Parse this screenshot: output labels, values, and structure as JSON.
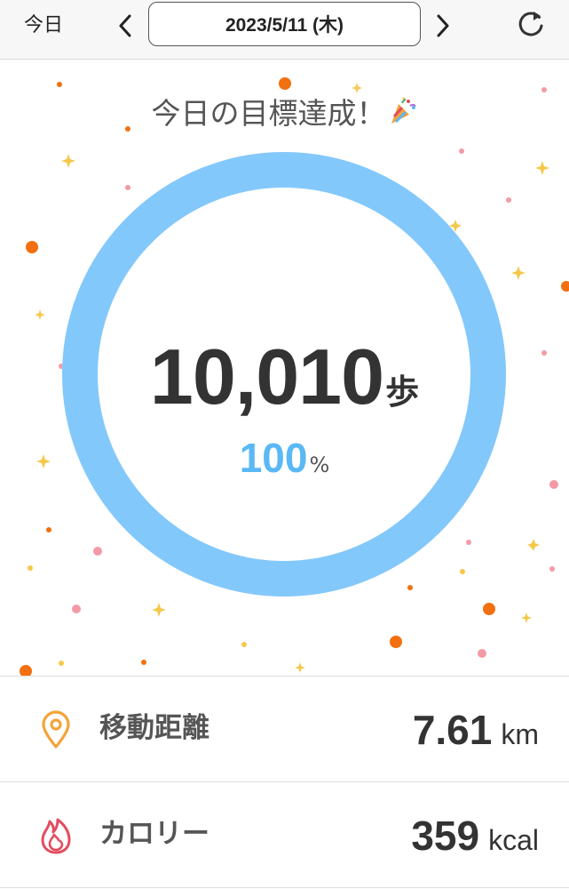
{
  "header": {
    "today_label": "今日",
    "date": "2023/5/11 (木)"
  },
  "goal": {
    "title": "今日の目標達成！",
    "badge_icon": "party-popper-icon"
  },
  "steps": {
    "count": "10,010",
    "unit": "歩",
    "percent": "100",
    "percent_sign": "%",
    "progress": 1.0
  },
  "stats": {
    "distance": {
      "icon": "map-pin-icon",
      "label": "移動距離",
      "value": "7.61",
      "unit": "km"
    },
    "calorie": {
      "icon": "flame-icon",
      "label": "カロリー",
      "value": "359",
      "unit": "kcal"
    }
  },
  "colors": {
    "ring": "#83c8fb",
    "percent": "#5ab8f5",
    "distance_icon": "#f3a33a",
    "calorie_icon": "#e34d5f",
    "confetti_orange": "#f2700f",
    "confetti_pink": "#f39aa6",
    "confetti_yellow": "#f5c84a"
  }
}
